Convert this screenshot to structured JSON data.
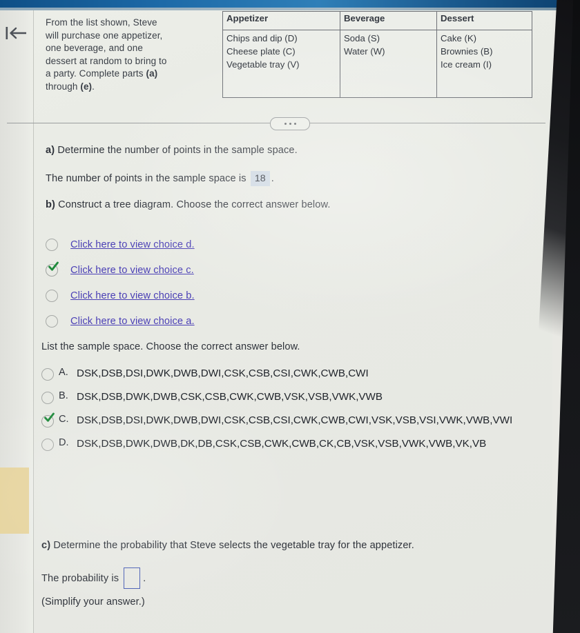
{
  "nav": {
    "back_icon": "back-to-start-arrow-icon",
    "back_label": "Back"
  },
  "problem": {
    "statement_line1": "From the list shown, Steve",
    "statement_line2": "will purchase one appetizer,",
    "statement_line3": "one beverage, and one",
    "statement_line4": "dessert at random to bring to",
    "statement_line5_a": "a party. Complete parts ",
    "statement_line5_b": "(a)",
    "statement_line6_a": "through ",
    "statement_line6_b": "(e)",
    "statement_line6_c": "."
  },
  "table": {
    "headers": [
      "Appetizer",
      "Beverage",
      "Dessert"
    ],
    "rows": [
      [
        "Chips and dip (D)",
        "Soda (S)",
        "Cake (K)"
      ],
      [
        "Cheese plate (C)",
        "Water (W)",
        "Brownies (B)"
      ],
      [
        "Vegetable tray (V)",
        "",
        "Ice cream (I)"
      ]
    ]
  },
  "divider": {
    "more_icon": "ellipsis-icon"
  },
  "parts": {
    "a": {
      "label": "a)",
      "prompt": " Determine the number of points in the sample space.",
      "answer_prefix": "The number of points in the sample space is",
      "answer_value": "18",
      "answer_suffix": "."
    },
    "b": {
      "label": "b)",
      "prompt": " Construct a tree diagram. Choose the correct answer below.",
      "choices": [
        {
          "text": "Click here to view choice d.",
          "selected": false
        },
        {
          "text": "Click here to view choice c.",
          "selected": true
        },
        {
          "text": "Click here to view choice b.",
          "selected": false
        },
        {
          "text": "Click here to view choice a.",
          "selected": false
        }
      ],
      "list_prompt": "List the sample space. Choose the correct answer below.",
      "mc_options": [
        {
          "letter": "A.",
          "text": "DSK,DSB,DSI,DWK,DWB,DWI,CSK,CSB,CSI,CWK,CWB,CWI",
          "selected": false
        },
        {
          "letter": "B.",
          "text": "DSK,DSB,DWK,DWB,CSK,CSB,CWK,CWB,VSK,VSB,VWK,VWB",
          "selected": false
        },
        {
          "letter": "C.",
          "text": "DSK,DSB,DSI,DWK,DWB,DWI,CSK,CSB,CSI,CWK,CWB,CWI,VSK,VSB,VSI,VWK,VWB,VWI",
          "selected": true
        },
        {
          "letter": "D.",
          "text": "DSK,DSB,DWK,DWB,DK,DB,CSK,CSB,CWK,CWB,CK,CB,VSK,VSB,VWK,VWB,VK,VB",
          "selected": false
        }
      ]
    },
    "c": {
      "label": "c)",
      "prompt": " Determine the probability that Steve selects the vegetable tray for the appetizer.",
      "answer_prefix": "The probability is",
      "answer_value": "",
      "answer_suffix": ".",
      "note": "(Simplify your answer.)"
    }
  },
  "colors": {
    "link": "#4a3fb5",
    "checkmark": "#1f8a3c",
    "highlight": "#cfd9e3",
    "answer_box_border": "#4a5fb5",
    "top_bar": "#1d6aa8",
    "sticky_note": "#e6d39a"
  }
}
